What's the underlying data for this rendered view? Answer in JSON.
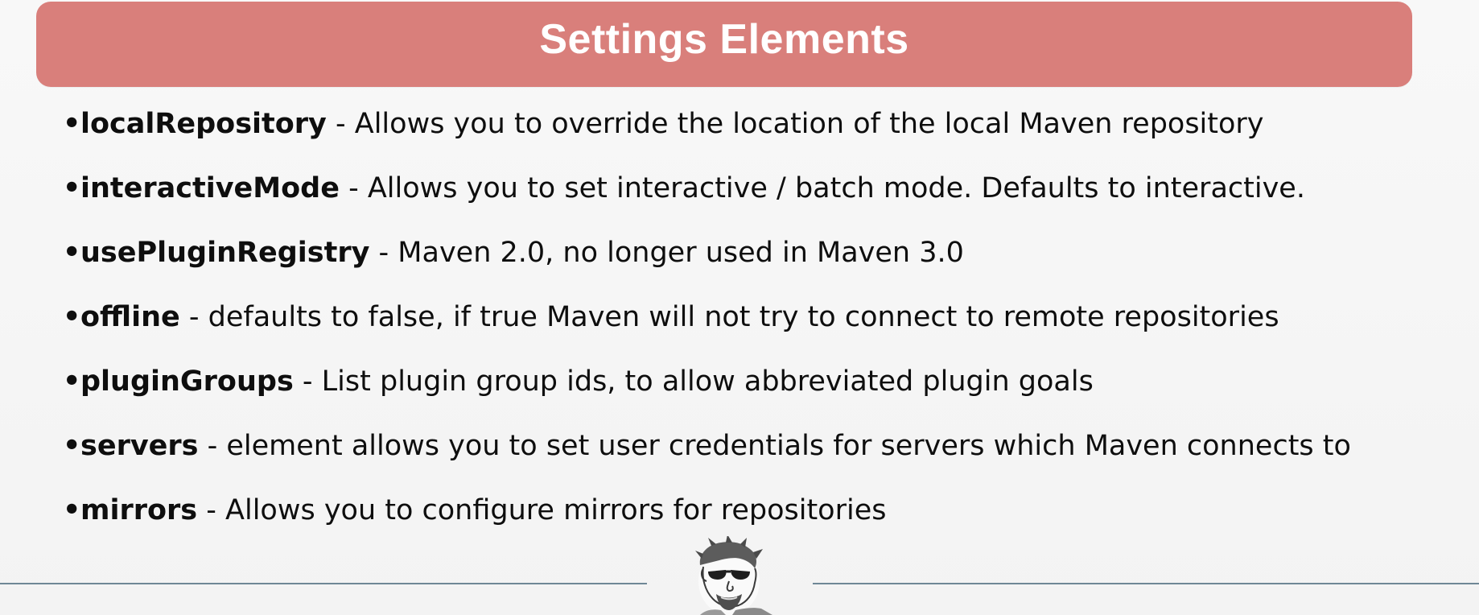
{
  "slide": {
    "title": "Settings Elements",
    "bullet_glyph": "•",
    "separator": " - ",
    "items": [
      {
        "term": "localRepository",
        "description": "Allows you to override the location of the local Maven repository"
      },
      {
        "term": "interactiveMode",
        "description": "Allows you to set interactive / batch mode. Defaults to interactive."
      },
      {
        "term": "usePluginRegistry",
        "description": "Maven 2.0, no longer used in Maven 3.0"
      },
      {
        "term": "offline",
        "description": "defaults to false, if true Maven will not try to connect to remote repositories"
      },
      {
        "term": "pluginGroups",
        "description": "List plugin group ids, to allow abbreviated plugin goals"
      },
      {
        "term": "servers",
        "description": "element allows you to set user credentials for servers which Maven connects to"
      },
      {
        "term": "mirrors",
        "description": "Allows you to configure mirrors for repositories"
      }
    ]
  },
  "colors": {
    "banner": "#d97f7b",
    "title_text": "#ffffff",
    "body_text": "#0e0e0e",
    "background": "#f6f6f6",
    "rule": "#6f8796"
  },
  "icons": {
    "mascot": "sunglasses-man-sketch-logo"
  }
}
